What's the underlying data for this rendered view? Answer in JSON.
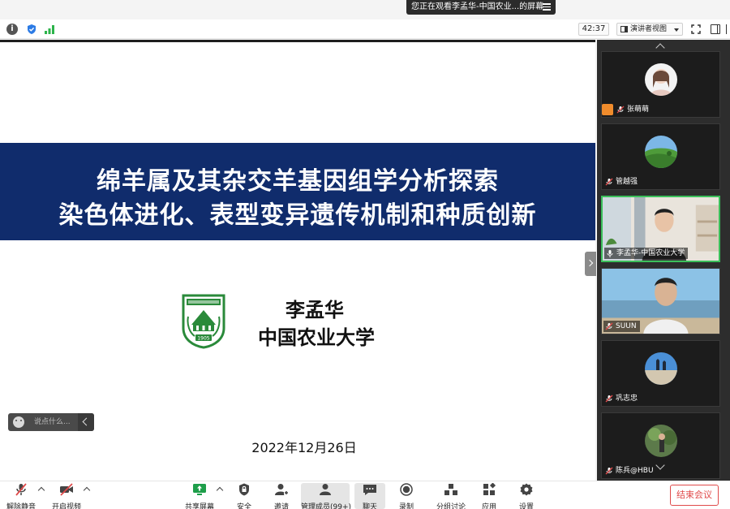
{
  "share_banner": {
    "text": "您正在观看李孟华-中国农业...的屏幕"
  },
  "status_bar": {
    "timer": "42:37",
    "view_mode": "演讲者视图"
  },
  "slide": {
    "title_line1": "绵羊属及其杂交羊基因组学分析探索",
    "title_line2": "染色体进化、表型变异遗传机制和种质创新",
    "author_name": "李孟华",
    "author_affiliation": "中国农业大学",
    "date": "2022年12月26日",
    "logo_year": "1905"
  },
  "chat_quick": {
    "placeholder": "说点什么..."
  },
  "participants": [
    {
      "name": "张萌萌"
    },
    {
      "name": "管越强"
    },
    {
      "name": "李孟华-中国农业大学"
    },
    {
      "name": "SUUN"
    },
    {
      "name": "巩志忠"
    },
    {
      "name": "陈兵@HBU"
    }
  ],
  "toolbar": {
    "unmute": "解除静音",
    "start_video": "开启视频",
    "share_screen": "共享屏幕",
    "security": "安全",
    "invite": "邀请",
    "manage_participants": "管理成员(99+)",
    "chat": "聊天",
    "record": "录制",
    "breakout": "分组讨论",
    "apps": "应用",
    "settings": "设置",
    "end_meeting": "结束会议"
  },
  "colors": {
    "title_band": "#102c6c",
    "active_speaker_border": "#3bbf5a",
    "end_meeting": "#e04a4a",
    "share_screen_icon": "#1e9e4a"
  },
  "icons": [
    "info-icon",
    "shield-icon",
    "signal-icon",
    "fullscreen-icon",
    "sidebar-toggle-icon",
    "mic-muted-icon",
    "video-off-icon",
    "share-screen-icon",
    "security-icon",
    "invite-icon",
    "participants-icon",
    "chat-icon",
    "record-icon",
    "breakout-icon",
    "apps-icon",
    "settings-icon"
  ]
}
